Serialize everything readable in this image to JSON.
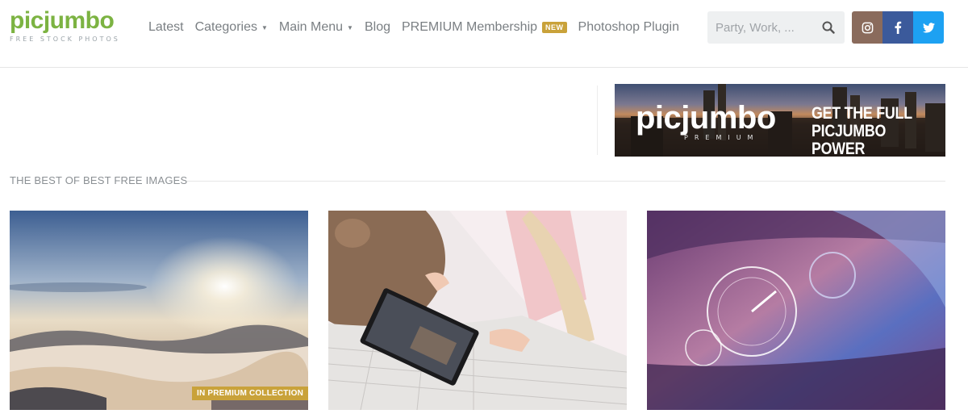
{
  "logo": {
    "name": "picjumbo",
    "tagline": "FREE STOCK PHOTOS"
  },
  "nav": {
    "items": [
      {
        "label": "Latest",
        "dropdown": false
      },
      {
        "label": "Categories",
        "dropdown": true
      },
      {
        "label": "Main Menu",
        "dropdown": true
      },
      {
        "label": "Blog",
        "dropdown": false
      },
      {
        "label": "PREMIUM Membership",
        "dropdown": false,
        "badge": "NEW"
      },
      {
        "label": "Photoshop Plugin",
        "dropdown": false
      }
    ]
  },
  "search": {
    "placeholder": "Party, Work, ...",
    "value": "",
    "icon": "search-icon"
  },
  "social": [
    {
      "network": "instagram",
      "icon": "instagram-icon",
      "color": "#8a6b5c"
    },
    {
      "network": "facebook",
      "icon": "facebook-icon",
      "color": "#3b5a9b"
    },
    {
      "network": "twitter",
      "icon": "twitter-icon",
      "color": "#1da1f2"
    }
  ],
  "banner": {
    "brand": "picjumbo",
    "sub": "PREMIUM",
    "cta": "GET THE FULL PICJUMBO POWER"
  },
  "section": {
    "title": "THE BEST OF BEST FREE IMAGES"
  },
  "photos": [
    {
      "subject": "sunrise over foggy mountains",
      "tag": "IN PREMIUM COLLECTION"
    },
    {
      "subject": "woman using tablet in bed with teddy bear",
      "tag": ""
    },
    {
      "subject": "car dashboard speedometer",
      "tag": ""
    }
  ],
  "colors": {
    "brand_green": "#7cb342",
    "accent_gold": "#c9a23a",
    "nav_text": "#7a7f83"
  }
}
